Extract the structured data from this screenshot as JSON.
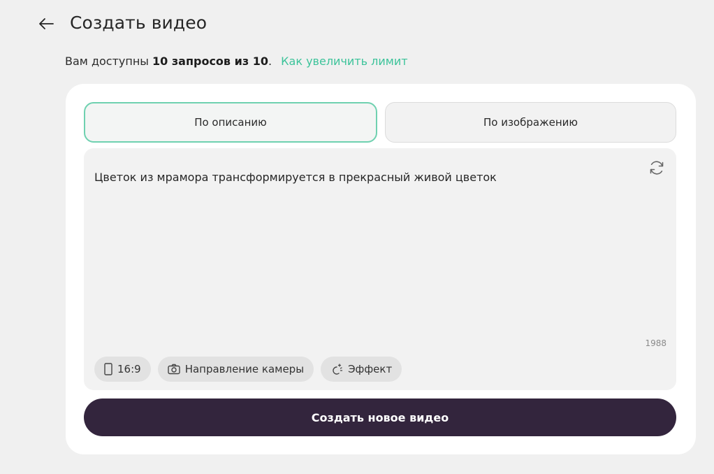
{
  "header": {
    "title": "Создать видео",
    "back_icon": "arrow-left-icon"
  },
  "limit": {
    "prefix": "Вам доступны ",
    "count": "10 запросов из 10",
    "suffix": ".",
    "link_label": "Как увеличить лимит",
    "link_color": "#3cc39a"
  },
  "tabs": [
    {
      "label": "По описанию",
      "active": true
    },
    {
      "label": "По изображению",
      "active": false
    }
  ],
  "prompt": {
    "value": "Цветок из мрамора трансформируется в прекрасный живой цветок",
    "char_count": "1988",
    "refresh_icon": "refresh-icon"
  },
  "chips": [
    {
      "label": "16:9",
      "icon": "aspect-ratio-icon"
    },
    {
      "label": "Направление камеры",
      "icon": "camera-icon"
    },
    {
      "label": "Эффект",
      "icon": "sparkle-effect-icon"
    }
  ],
  "actions": {
    "create_label": "Создать новое видео",
    "create_color": "#33253d"
  }
}
